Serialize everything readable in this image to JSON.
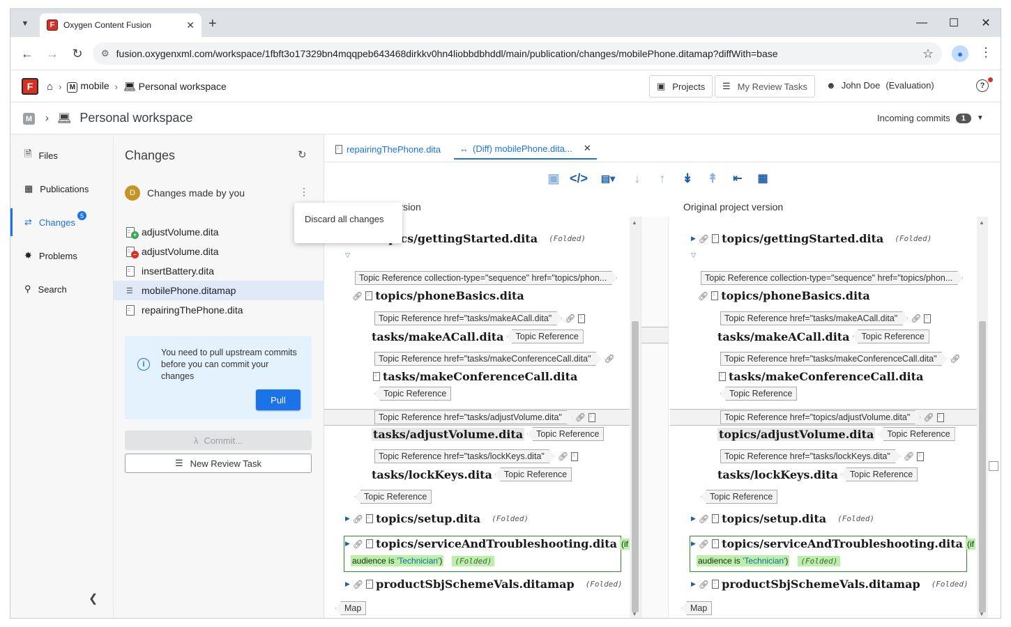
{
  "browser": {
    "tab_title": "Oxygen Content Fusion",
    "url": "fusion.oxygenxml.com/workspace/1fbft3o17329bn4mqqpeb643468dirkkv0hn4liobbdbhddl/main/publication/changes/mobilePhone.ditamap?diffWith=base",
    "favicon_letter": "F"
  },
  "header": {
    "logo_letter": "F",
    "crumb_project": "mobile",
    "crumb_project_letter": "M",
    "crumb_workspace": "Personal workspace",
    "projects_label": "Projects",
    "review_label": "My Review Tasks",
    "user_name": "John Doe",
    "user_status": "(Evaluation)",
    "help": "?"
  },
  "workspace": {
    "letter": "M",
    "title": "Personal workspace",
    "incoming_label": "Incoming commits",
    "incoming_count": "1"
  },
  "nav": {
    "files": "Files",
    "publications": "Publications",
    "changes": "Changes",
    "changes_badge": "5",
    "problems": "Problems",
    "search": "Search"
  },
  "changes": {
    "title": "Changes",
    "owner_initial": "D",
    "owner_label": "Changes made by you",
    "files": [
      {
        "name": "adjustVolume.dita",
        "status": "added"
      },
      {
        "name": "adjustVolume.dita",
        "status": "deleted"
      },
      {
        "name": "insertBattery.dita",
        "status": "modified"
      },
      {
        "name": "mobilePhone.ditamap",
        "status": "selected"
      },
      {
        "name": "repairingThePhone.dita",
        "status": "modified"
      }
    ],
    "info_text": "You need to pull upstream commits before you can commit your changes",
    "pull_label": "Pull",
    "commit_label": "Commit...",
    "review_task_label": "New Review Task",
    "popup_label": "Discard all changes"
  },
  "editor": {
    "tab1": "repairingThePhone.dita",
    "tab2": "(Diff) mobilePhone.dita...",
    "left_label": "Workspace version",
    "right_label": "Original project version",
    "left": {
      "getting_started": "topics/gettingStarted.dita",
      "folded": "(Folded)",
      "phone_basics_tag": "Topic Reference collection-type=\"sequence\" href=\"topics/phon...",
      "phone_basics": "topics/phoneBasics.dita",
      "make_call_tag": "Topic Reference href=\"tasks/makeACall.dita\"",
      "make_call": "tasks/makeACall.dita",
      "topic_ref": "Topic Reference",
      "conf_tag": "Topic Reference href=\"tasks/makeConferenceCall.dita\"",
      "conf": "tasks/makeConferenceCall.dita",
      "adjust_tag": "Topic Reference href=\"tasks/adjustVolume.dita\"",
      "adjust": "tasks/adjustVolume.dita",
      "lock_tag": "Topic Reference href=\"tasks/lockKeys.dita\"",
      "lock": "tasks/lockKeys.dita",
      "setup": "topics/setup.dita",
      "service": "topics/serviceAndTroubleshooting.dita",
      "cond_if": "(if",
      "cond_audience": "audience is",
      "cond_value": "'Technician'",
      "cond_close": ")",
      "scheme": "productSbjSchemeVals.ditamap",
      "map": "Map"
    },
    "right": {
      "getting_started": "topics/gettingStarted.dita",
      "folded": "(Folded)",
      "phone_basics_tag": "Topic Reference collection-type=\"sequence\" href=\"topics/phon...",
      "phone_basics": "topics/phoneBasics.dita",
      "make_call_tag": "Topic Reference href=\"tasks/makeACall.dita\"",
      "make_call": "tasks/makeACall.dita",
      "topic_ref": "Topic Reference",
      "conf_tag": "Topic Reference href=\"tasks/makeConferenceCall.dita\"",
      "conf": "tasks/makeConferenceCall.dita",
      "adjust_tag": "Topic Reference href=\"topics/adjustVolume.dita\"",
      "adjust": "topics/adjustVolume.dita",
      "lock_tag": "Topic Reference href=\"tasks/lockKeys.dita\"",
      "lock": "tasks/lockKeys.dita",
      "setup": "topics/setup.dita",
      "service": "topics/serviceAndTroubleshooting.dita",
      "cond_if": "(if",
      "cond_audience": "audience is",
      "cond_value": "'Technician'",
      "cond_close": ")",
      "scheme": "productSbjSchemeVals.ditamap",
      "map": "Map"
    }
  },
  "colors": {
    "accent": "#1a73e8",
    "condition_bg": "#b9f2a6",
    "condition_border": "#2e8b2e",
    "added": "#34a853",
    "deleted": "#d93025"
  }
}
